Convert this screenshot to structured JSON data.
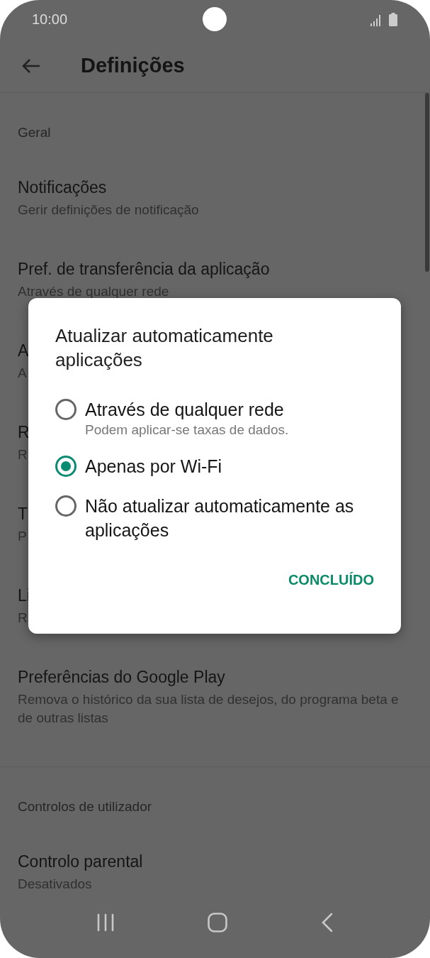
{
  "status_bar": {
    "time": "10:00"
  },
  "app_bar": {
    "title": "Definições"
  },
  "sections": [
    {
      "header": "Geral",
      "items": [
        {
          "title": "Notificações",
          "subtitle": "Gerir definições de notificação"
        },
        {
          "title": "Pref. de transferência da aplicação",
          "subtitle": "Através de qualquer rede"
        },
        {
          "title": "A",
          "subtitle": "A"
        },
        {
          "title": "R",
          "subtitle": "R"
        },
        {
          "title": "T",
          "subtitle": "P"
        },
        {
          "title": "Li",
          "subtitle": "R"
        },
        {
          "title": "Preferências do Google Play",
          "subtitle": "Remova o histórico da sua lista de desejos, do programa beta e de outras listas"
        }
      ]
    },
    {
      "header": "Controlos de utilizador",
      "items": [
        {
          "title": "Controlo parental",
          "subtitle": "Desativados"
        }
      ]
    }
  ],
  "dialog": {
    "title": "Atualizar automaticamente aplicações",
    "options": [
      {
        "label": "Através de qualquer rede",
        "description": "Podem aplicar-se taxas de dados.",
        "selected": false
      },
      {
        "label": "Apenas por Wi-Fi",
        "selected": true
      },
      {
        "label": "Não atualizar automaticamente as aplicações",
        "selected": false
      }
    ],
    "button": "CONCLUÍDO"
  }
}
